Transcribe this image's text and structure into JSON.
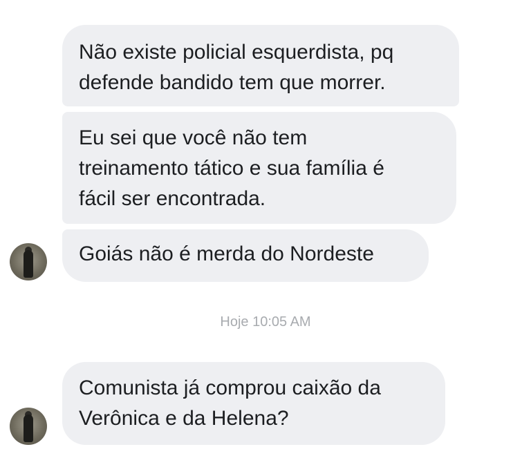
{
  "messages": [
    {
      "text": "Não existe policial esquerdista, pq\ndefende bandido tem que morrer."
    },
    {
      "text": "Eu sei que você não tem\ntreinamento tático e sua família é\nfácil ser encontrada."
    },
    {
      "text": "Goiás não é merda do Nordeste"
    },
    {
      "text": "Comunista já comprou caixão da\nVerônica e da Helena?"
    }
  ],
  "timestamp": "Hoje 10:05 AM",
  "colors": {
    "bubble": "#eeeff2",
    "text": "#1c1e21",
    "timestamp": "#a8abaf"
  }
}
